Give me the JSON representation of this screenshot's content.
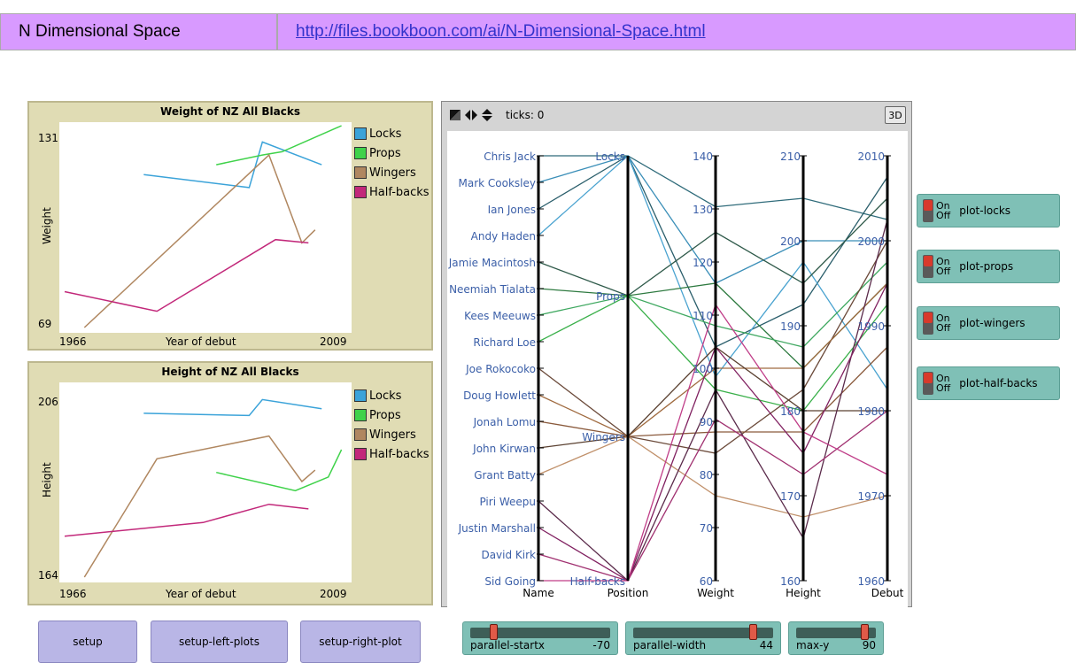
{
  "header": {
    "title": "N Dimensional Space",
    "link": "http://files.bookboon.com/ai/N-Dimensional-Space.html"
  },
  "plots": [
    {
      "title": "Weight of NZ All Blacks",
      "ylabel": "Weight",
      "xlabel": "Year of debut",
      "xmin_label": "1966",
      "xmax_label": "2009",
      "ymin_label": "69",
      "ymax_label": "131"
    },
    {
      "title": "Height of NZ All Blacks",
      "ylabel": "Height",
      "xlabel": "Year of debut",
      "xmin_label": "1966",
      "xmax_label": "2009",
      "ymin_label": "164",
      "ymax_label": "206"
    }
  ],
  "legend": [
    {
      "label": "Locks",
      "color": "#3ba3d9"
    },
    {
      "label": "Props",
      "color": "#3fd24a"
    },
    {
      "label": "Wingers",
      "color": "#b08760"
    },
    {
      "label": "Half-backs",
      "color": "#c2287a"
    }
  ],
  "chart_data": [
    {
      "type": "line",
      "title": "Weight of NZ All Blacks",
      "xlabel": "Year of debut",
      "ylabel": "Weight",
      "xlim": [
        1966,
        2009
      ],
      "ylim": [
        69,
        131
      ],
      "series": [
        {
          "name": "Locks",
          "x": [
            1978,
            1994,
            1996,
            2005
          ],
          "y": [
            116,
            112,
            126,
            119
          ]
        },
        {
          "name": "Props",
          "x": [
            1989,
            1996,
            1999,
            2008
          ],
          "y": [
            119,
            122,
            123,
            131
          ]
        },
        {
          "name": "Wingers",
          "x": [
            1969,
            1997,
            2002,
            2004
          ],
          "y": [
            69,
            122,
            95,
            99
          ]
        },
        {
          "name": "Half-backs",
          "x": [
            1966,
            1980,
            1998,
            2003
          ],
          "y": [
            80,
            74,
            96,
            95
          ]
        }
      ]
    },
    {
      "type": "line",
      "title": "Height of NZ All Blacks",
      "xlabel": "Year of debut",
      "ylabel": "Height",
      "xlim": [
        1966,
        2009
      ],
      "ylim": [
        164,
        206
      ],
      "series": [
        {
          "name": "Locks",
          "x": [
            1978,
            1994,
            1996,
            2005
          ],
          "y": [
            200,
            199.5,
            203,
            201
          ]
        },
        {
          "name": "Props",
          "x": [
            1989,
            2001,
            2006,
            2008
          ],
          "y": [
            187,
            183,
            186,
            192
          ]
        },
        {
          "name": "Wingers",
          "x": [
            1969,
            1980,
            1997,
            2002,
            2004
          ],
          "y": [
            164,
            190,
            195,
            185,
            187.5
          ]
        },
        {
          "name": "Half-backs",
          "x": [
            1966,
            1987,
            1997,
            2003
          ],
          "y": [
            173,
            176,
            180,
            179
          ]
        }
      ]
    }
  ],
  "view": {
    "ticks_label": "ticks: 0",
    "btn_3d": "3D",
    "axes": [
      "Name",
      "Position",
      "Weight",
      "Height",
      "Debut"
    ],
    "names": [
      "Chris Jack",
      "Mark Cooksley",
      "Ian Jones",
      "Andy Haden",
      "Jamie Macintosh",
      "Neemiah Tialata",
      "Kees Meeuws",
      "Richard Loe",
      "Joe Rokocoko",
      "Doug Howlett",
      "Jonah Lomu",
      "John Kirwan",
      "Grant Batty",
      "Piri Weepu",
      "Justin Marshall",
      "David Kirk",
      "Sid Going"
    ],
    "positions": [
      "Locks",
      "Props",
      "Wingers",
      "Half-backs"
    ],
    "weight_ticks": [
      "140",
      "130",
      "120",
      "110",
      "100",
      "90",
      "80",
      "70",
      "60"
    ],
    "height_ticks": [
      "210",
      "200",
      "190",
      "180",
      "170",
      "160"
    ],
    "debut_ticks": [
      "2010",
      "2000",
      "1990",
      "1980",
      "1970",
      "1960"
    ]
  },
  "switches": [
    {
      "label": "plot-locks",
      "on": "On",
      "off": "Off"
    },
    {
      "label": "plot-props",
      "on": "On",
      "off": "Off"
    },
    {
      "label": "plot-wingers",
      "on": "On",
      "off": "Off"
    },
    {
      "label": "plot-half-backs",
      "on": "On",
      "off": "Off"
    }
  ],
  "buttons": [
    "setup",
    "setup-left-plots",
    "setup-right-plot"
  ],
  "sliders": [
    {
      "label": "parallel-startx",
      "value": "-70",
      "fraction": 0.15
    },
    {
      "label": "parallel-width",
      "value": "44",
      "fraction": 0.88
    },
    {
      "label": "max-y",
      "value": "90",
      "fraction": 0.9
    }
  ]
}
